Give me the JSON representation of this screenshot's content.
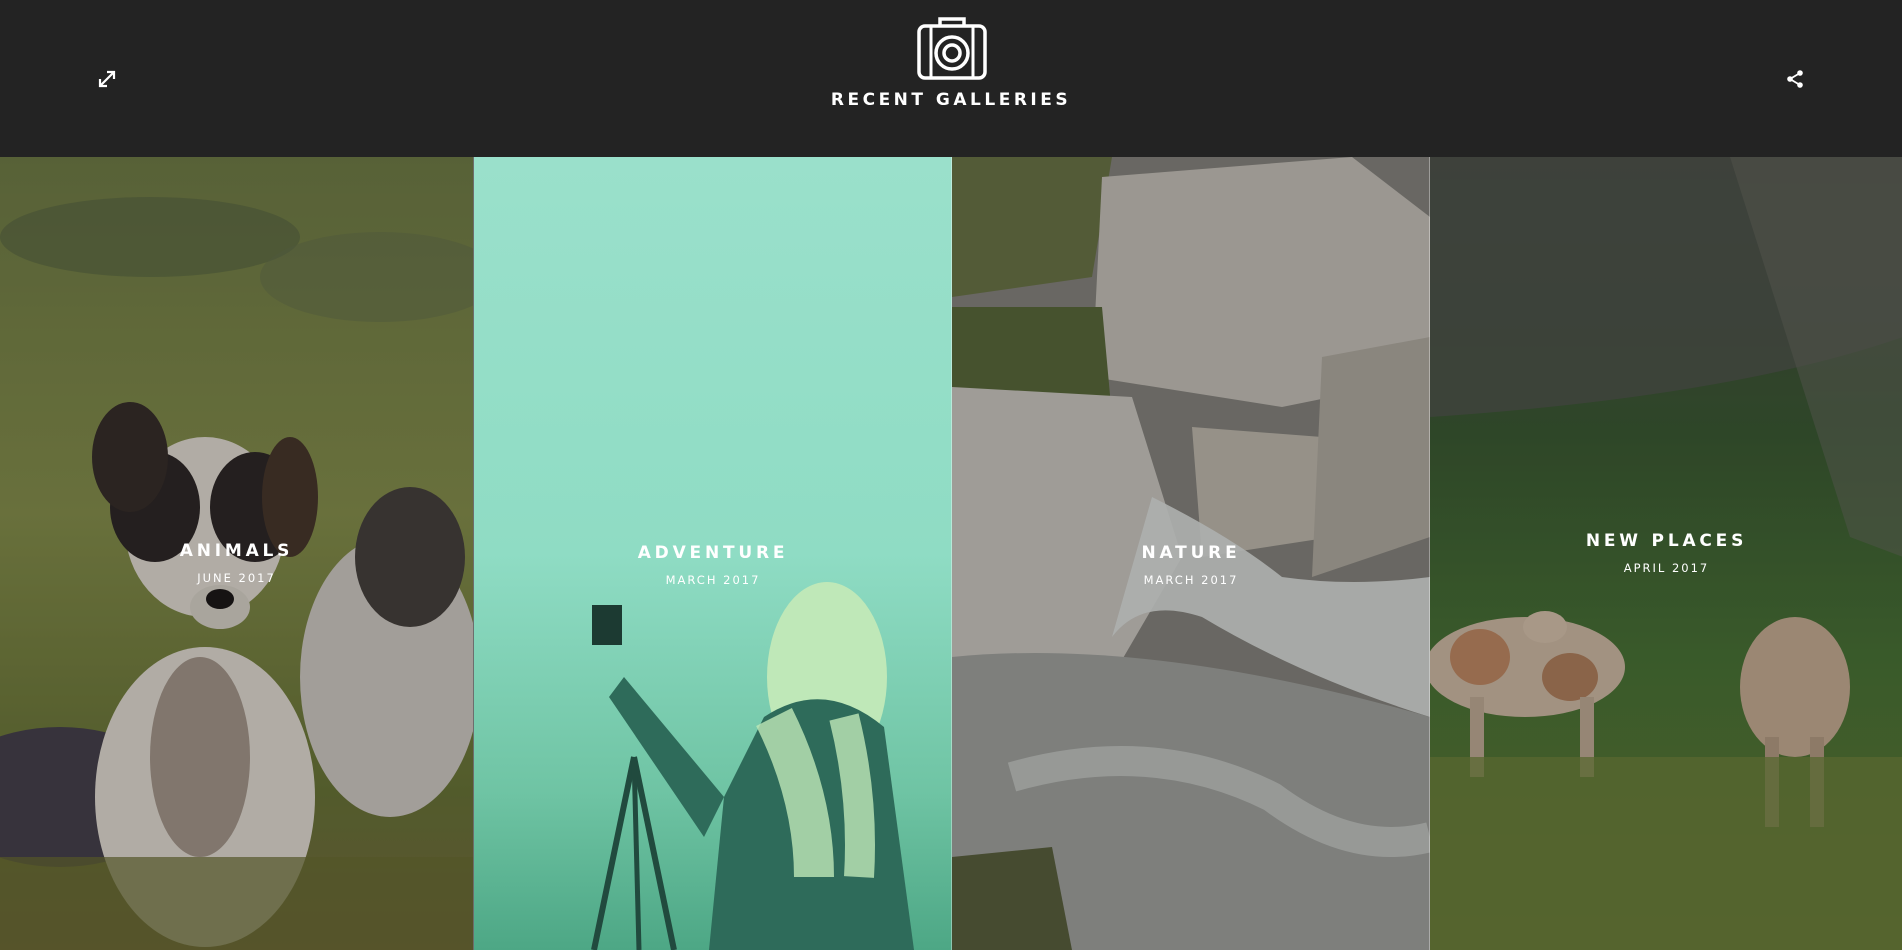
{
  "header": {
    "title": "RECENT GALLERIES",
    "logo_icon": "camera-icon",
    "expand_icon": "expand-icon",
    "share_icon": "share-icon",
    "background_color": "#232323"
  },
  "galleries": [
    {
      "title": "ANIMALS",
      "date": "JUNE 2017",
      "scene": "dogs-on-grass"
    },
    {
      "title": "ADVENTURE",
      "date": "MARCH 2017",
      "scene": "photographer-in-fog",
      "highlight_color": "#8fdcc4"
    },
    {
      "title": "NATURE",
      "date": "MARCH 2017",
      "scene": "mountain-stream-rocks"
    },
    {
      "title": "NEW PLACES",
      "date": "APRIL 2017",
      "scene": "cows-in-valley"
    }
  ]
}
